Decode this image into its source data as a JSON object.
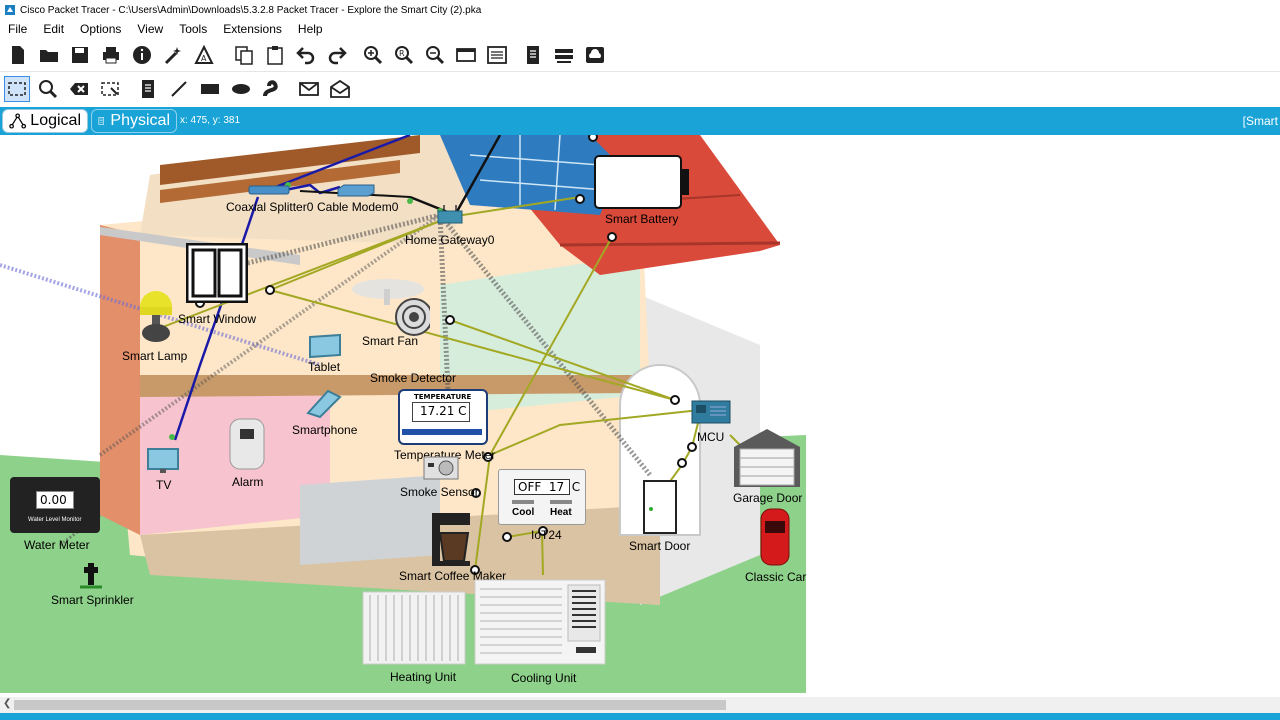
{
  "window": {
    "title": "Cisco Packet Tracer - C:\\Users\\Admin\\Downloads\\5.3.2.8 Packet Tracer - Explore the Smart City (2).pka"
  },
  "menu": [
    "File",
    "Edit",
    "Options",
    "View",
    "Tools",
    "Extensions",
    "Help"
  ],
  "toolbar_main": [
    "new-icon",
    "open-icon",
    "save-icon",
    "print-icon",
    "info-icon",
    "wizard-icon",
    "activity-icon",
    "copy-icon",
    "paste-icon",
    "undo-icon",
    "redo-icon",
    "zoom-in-icon",
    "zoom-reset-icon",
    "zoom-out-icon",
    "palette-icon",
    "custom-devices-icon",
    "note-icon",
    "router-icon",
    "cloud-icon"
  ],
  "toolbar_tools": [
    "select-icon",
    "inspect-icon",
    "delete-icon",
    "resize-icon",
    "place-note-icon",
    "draw-line-icon",
    "rectangle-icon",
    "ellipse-icon",
    "freeform-icon",
    "add-pdu-icon",
    "add-complex-pdu-icon"
  ],
  "modebar": {
    "logical_label": "Logical",
    "physical_label": "Physical",
    "coordinates": "x: 475, y: 381",
    "right_label": "[Smart"
  },
  "devices": {
    "coaxial_splitter": "Coaxial Splitter0",
    "cable_modem": "Cable Modem0",
    "home_gateway": "Home Gateway0",
    "smart_battery": "Smart Battery",
    "smart_window": "Smart Window",
    "smart_lamp": "Smart Lamp",
    "smart_fan": "Smart Fan",
    "tablet": "Tablet",
    "smoke_detector": "Smoke Detector",
    "smartphone": "Smartphone",
    "temperature_meter": "Temperature Meter",
    "temperature_heading": "TEMPERATURE",
    "temperature_value": "17.21 C",
    "mcu": "MCU",
    "garage_door": "Garage Door",
    "tv": "TV",
    "alarm": "Alarm",
    "smoke_sensor": "Smoke Sensor",
    "thermostat": "IoT24",
    "thermostat_display": "OFF  17  C",
    "thermostat_cool": "Cool",
    "thermostat_heat": "Heat",
    "smart_door": "Smart Door",
    "classic_car": "Classic Car",
    "water_meter": "Water Meter",
    "water_meter_value": "0.00",
    "water_meter_caption": "Water Level Monitor",
    "smart_sprinkler": "Smart Sprinkler",
    "smart_coffee_maker": "Smart Coffee Maker",
    "heating_unit": "Heating Unit",
    "cooling_unit": "Cooling Unit"
  },
  "colors": {
    "accent_bar": "#1aa3d6",
    "grass": "#8ed18a",
    "roof": "#d94a3a",
    "cable_blue": "#1a1aa8",
    "cable_olive": "#a3a823"
  }
}
